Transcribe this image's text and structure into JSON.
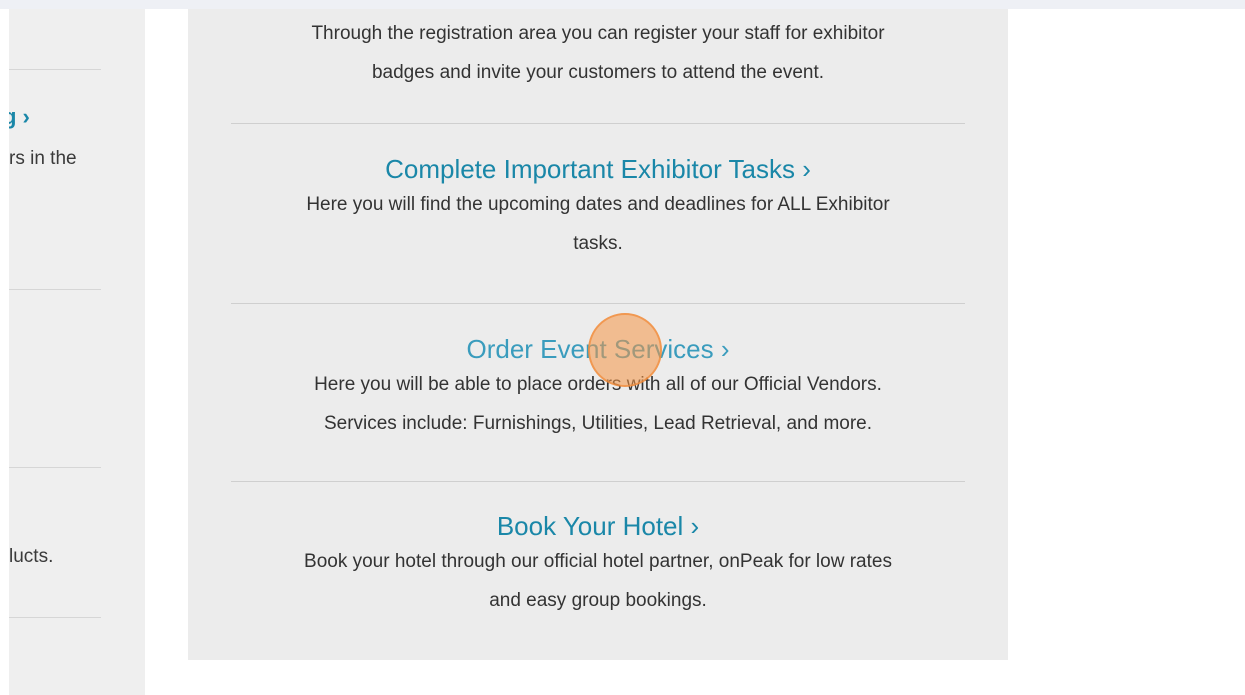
{
  "sidebar": {
    "link_fragment": "g ›",
    "text1": "rs in the",
    "text2": ".",
    "text3": "lucts."
  },
  "card": {
    "intro": {
      "line1": "Through the registration area you can register your staff for exhibitor",
      "line2": "badges and invite your customers to attend the event."
    },
    "sections": [
      {
        "title": "Complete Important Exhibitor Tasks ›",
        "desc_line1": "Here you will find the upcoming dates and deadlines for ALL Exhibitor",
        "desc_line2": "tasks."
      },
      {
        "title": "Order Event Services ›",
        "desc_line1": "Here you will be able to place orders with all of our Official Vendors.",
        "desc_line2": "Services include: Furnishings, Utilities, Lead Retrieval, and more."
      },
      {
        "title": "Book Your Hotel ›",
        "desc_line1": "Book your hotel through our official hotel partner, onPeak for low rates",
        "desc_line2": "and easy group bookings."
      }
    ]
  }
}
